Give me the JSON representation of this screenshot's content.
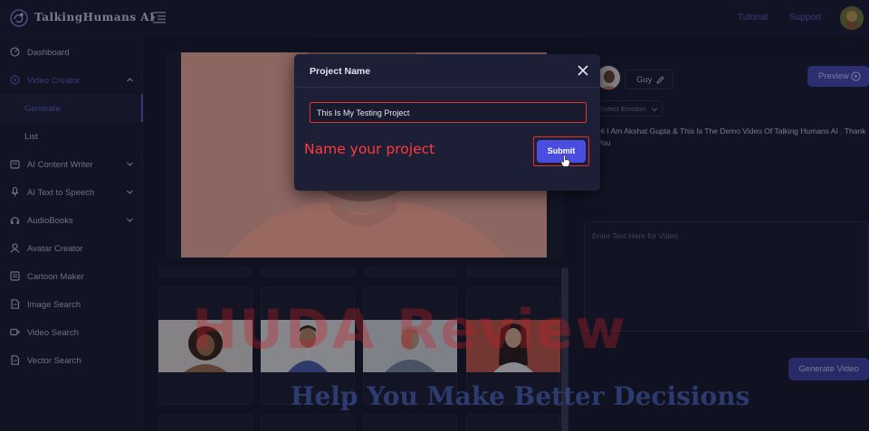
{
  "app": {
    "logo_text": "TalkingHumans AI",
    "logo_icon": "brain-icon",
    "menu_toggle_icon": "collapse-menu-icon"
  },
  "header": {
    "links": [
      "Tutorial",
      "Support"
    ]
  },
  "sidebar": {
    "items": [
      {
        "label": "Dashboard",
        "icon": "dashboard-icon"
      },
      {
        "label": "Video Creator",
        "icon": "play-circle-icon"
      },
      {
        "label": "Generate"
      },
      {
        "label": "List"
      },
      {
        "label": "AI Content Writer",
        "icon": "edit-icon"
      },
      {
        "label": "AI Text to Speech",
        "icon": "mic-icon"
      },
      {
        "label": "AudioBooks",
        "icon": "headphones-icon"
      },
      {
        "label": "Avatar Creator",
        "icon": "user-icon"
      },
      {
        "label": "Cartoon Maker",
        "icon": "book-icon"
      },
      {
        "label": "Image Search",
        "icon": "file-icon"
      },
      {
        "label": "Video Search",
        "icon": "video-icon"
      },
      {
        "label": "Vector Search",
        "icon": "file-icon"
      }
    ]
  },
  "editor": {
    "avatar_name": "Guy",
    "emotion_placeholder": "Select Emotion",
    "preview_label": "Preview",
    "script_text": "Hi I Am Akshat Gupta & This Is The Demo Video Of Talking Humans AI . Thank You",
    "video_text_placeholder": "Enter Text Here for Video",
    "generate_label": "Generate Video"
  },
  "modal": {
    "title": "Project Name",
    "input_value": "This Is My Testing Project",
    "hint": "Name your project",
    "submit_label": "Submit"
  },
  "watermark": {
    "big": "HUDA Review",
    "tagline": "Help You Make Better Decisions"
  },
  "colors": {
    "accent": "#5b5fc7",
    "button": "#4a4ee0",
    "highlight": "#e03131",
    "background": "#15172a"
  }
}
